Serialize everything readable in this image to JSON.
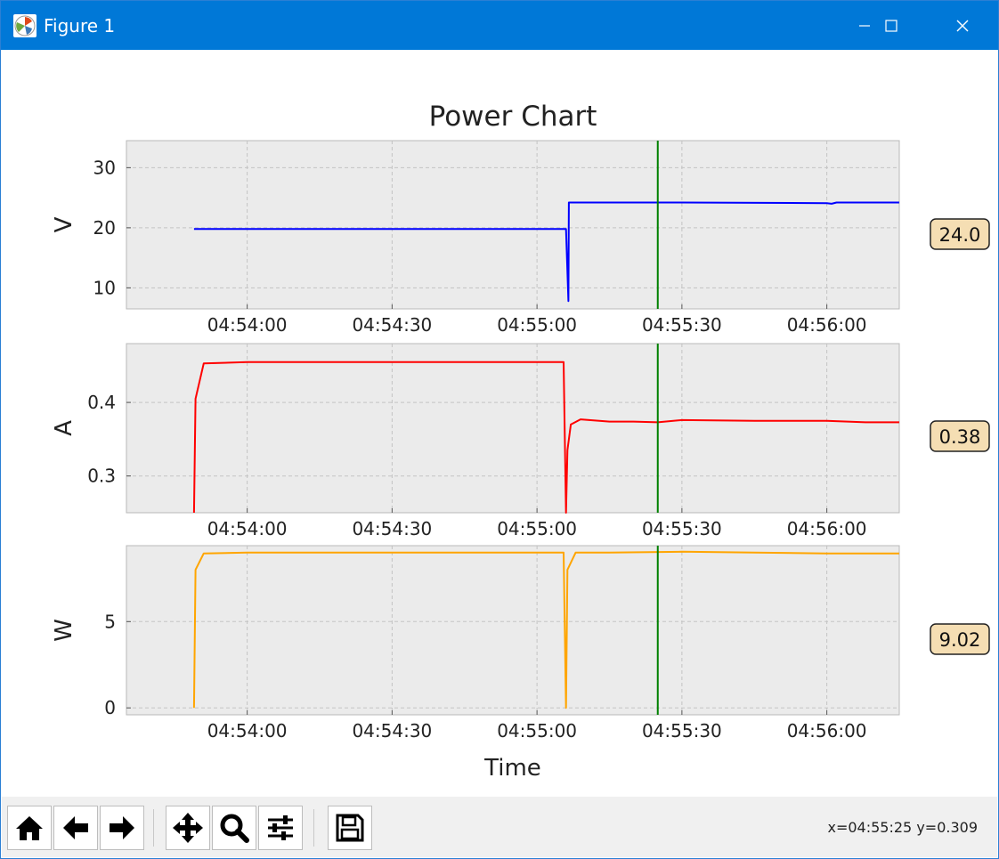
{
  "window": {
    "title": "Figure 1",
    "minimize_glyph": "—",
    "maximize_glyph": "☐",
    "close_glyph": "✕"
  },
  "figure": {
    "title": "Power Chart",
    "xlabel": "Time",
    "cursor_time": "04:55:25",
    "colors": {
      "v": "#0000ff",
      "a": "#ff0000",
      "w": "#ffa500",
      "cursor": "#008000",
      "axes_bg": "#ebebeb",
      "label_bg": "#f5deb3"
    },
    "readouts": {
      "v": "24.0",
      "a": "0.38",
      "w": "9.02"
    }
  },
  "chart_data": [
    {
      "type": "line",
      "ylabel": "V",
      "yticks": [
        "10",
        "20",
        "30"
      ],
      "xticks": [
        "04:54:00",
        "04:54:30",
        "04:55:00",
        "04:55:30",
        "04:56:00"
      ],
      "ylim": [
        6.5,
        34.5
      ],
      "xlim": [
        "04:53:35",
        "04:56:15"
      ],
      "series": [
        {
          "color": "#0000ff",
          "x": [
            "04:53:49",
            "04:54:00",
            "04:54:30",
            "04:55:00",
            "04:55:06",
            "04:55:06.5",
            "04:55:06.6",
            "04:55:07",
            "04:55:30",
            "04:56:00",
            "04:56:01",
            "04:56:02",
            "04:56:15"
          ],
          "y": [
            19.8,
            19.8,
            19.8,
            19.8,
            19.8,
            7.8,
            24.2,
            24.2,
            24.2,
            24.1,
            24.0,
            24.2,
            24.2
          ]
        }
      ]
    },
    {
      "type": "line",
      "ylabel": "A",
      "yticks": [
        "0.3",
        "0.4"
      ],
      "xticks": [
        "04:54:00",
        "04:54:30",
        "04:55:00",
        "04:55:30",
        "04:56:00"
      ],
      "ylim": [
        0.25,
        0.48
      ],
      "xlim": [
        "04:53:35",
        "04:56:15"
      ],
      "series": [
        {
          "color": "#ff0000",
          "x": [
            "04:53:49",
            "04:53:49.3",
            "04:53:51",
            "04:54:00",
            "04:54:10",
            "04:54:20",
            "04:54:30",
            "04:54:40",
            "04:54:50",
            "04:55:00",
            "04:55:04",
            "04:55:05.5",
            "04:55:06",
            "04:55:06.3",
            "04:55:07",
            "04:55:09",
            "04:55:15",
            "04:55:20",
            "04:55:25",
            "04:55:30",
            "04:55:45",
            "04:56:00",
            "04:56:08",
            "04:56:15"
          ],
          "y": [
            0.25,
            0.405,
            0.453,
            0.455,
            0.455,
            0.455,
            0.455,
            0.455,
            0.455,
            0.455,
            0.455,
            0.455,
            0.25,
            0.335,
            0.37,
            0.377,
            0.374,
            0.374,
            0.373,
            0.376,
            0.375,
            0.375,
            0.373,
            0.373
          ]
        }
      ]
    },
    {
      "type": "line",
      "ylabel": "W",
      "yticks": [
        "0",
        "5"
      ],
      "xticks": [
        "04:54:00",
        "04:54:30",
        "04:55:00",
        "04:55:30",
        "04:56:00"
      ],
      "ylim": [
        -0.4,
        9.4
      ],
      "xlim": [
        "04:53:35",
        "04:56:15"
      ],
      "series": [
        {
          "color": "#ffa500",
          "x": [
            "04:53:49",
            "04:53:49.3",
            "04:53:51",
            "04:54:00",
            "04:54:15",
            "04:54:30",
            "04:54:45",
            "04:55:00",
            "04:55:04",
            "04:55:05.5",
            "04:55:06",
            "04:55:06.3",
            "04:55:08",
            "04:55:15",
            "04:55:30",
            "04:55:45",
            "04:56:00",
            "04:56:15"
          ],
          "y": [
            0,
            8.0,
            8.95,
            9.0,
            9.0,
            9.0,
            9.0,
            9.0,
            9.0,
            9.0,
            0,
            8.0,
            9.0,
            9.0,
            9.05,
            9.0,
            8.95,
            8.95
          ]
        }
      ]
    }
  ],
  "toolbar": {
    "buttons": [
      "home",
      "back",
      "forward",
      "pan",
      "zoom",
      "configure-subplots",
      "save"
    ],
    "coords": "x=04:55:25 y=0.309"
  }
}
